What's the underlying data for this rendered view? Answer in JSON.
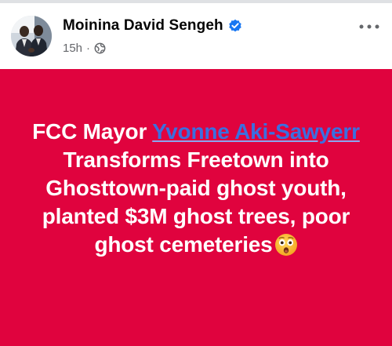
{
  "post": {
    "author": "Moinina David Sengeh",
    "timestamp": "15h",
    "separator": "·",
    "verified": true,
    "audience_icon": "globe-icon",
    "more_icon": "more-options-icon"
  },
  "card": {
    "background": "#e0033e",
    "text_parts": {
      "prefix": "FCC Mayor ",
      "mention": "Yvonne Aki-Sawyerr",
      "suffix": " Transforms Freetown into Ghosttown-paid ghost youth, planted $3M ghost trees, poor ghost cemeteries",
      "emoji": "astonished-face-emoji"
    }
  },
  "colors": {
    "verified_blue": "#1877f2",
    "mention_blue": "#3b6fe0",
    "meta_gray": "#65676b"
  }
}
